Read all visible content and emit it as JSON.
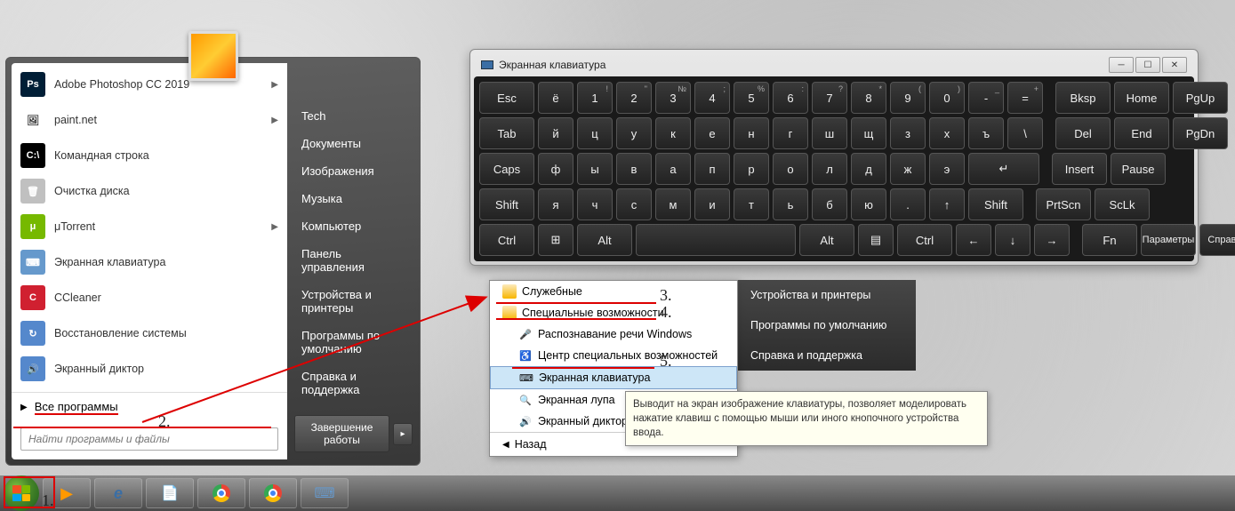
{
  "start_menu": {
    "programs": [
      {
        "label": "Adobe Photoshop CC 2019",
        "icon_bg": "#001e36",
        "icon_text": "Ps",
        "has_sub": true
      },
      {
        "label": "paint.net",
        "icon_bg": "#ffffff",
        "icon_text": "🖼",
        "has_sub": true
      },
      {
        "label": "Командная строка",
        "icon_bg": "#000000",
        "icon_text": "C:\\",
        "has_sub": false
      },
      {
        "label": "Очистка диска",
        "icon_bg": "#c0c0c0",
        "icon_text": "🗑",
        "has_sub": false
      },
      {
        "label": "μTorrent",
        "icon_bg": "#76b900",
        "icon_text": "μ",
        "has_sub": true
      },
      {
        "label": "Экранная клавиатура",
        "icon_bg": "#6699cc",
        "icon_text": "⌨",
        "has_sub": false
      },
      {
        "label": "CCleaner",
        "icon_bg": "#d02030",
        "icon_text": "C",
        "has_sub": false
      },
      {
        "label": "Восстановление системы",
        "icon_bg": "#5588cc",
        "icon_text": "↻",
        "has_sub": false
      },
      {
        "label": "Экранный диктор",
        "icon_bg": "#5588cc",
        "icon_text": "🔊",
        "has_sub": false
      }
    ],
    "all_programs": "Все программы",
    "search_placeholder": "Найти программы и файлы",
    "right_items": [
      "Tech",
      "Документы",
      "Изображения",
      "Музыка",
      "Компьютер",
      "Панель управления",
      "Устройства и принтеры",
      "Программы по умолчанию",
      "Справка и поддержка"
    ],
    "shutdown": "Завершение работы"
  },
  "osk": {
    "title": "Экранная клавиатура",
    "rows": [
      {
        "main": [
          "Esc",
          "ё",
          "1",
          "2",
          "3",
          "4",
          "5",
          "6",
          "7",
          "8",
          "9",
          "0",
          "-",
          "="
        ],
        "mods": [
          "",
          "",
          "!",
          "\"",
          "№",
          ";",
          "%",
          ":",
          "?",
          "*",
          "(",
          ")",
          "_",
          "+"
        ],
        "right": [
          "Bksp",
          "Home",
          "PgUp"
        ]
      },
      {
        "main": [
          "Tab",
          "й",
          "ц",
          "у",
          "к",
          "е",
          "н",
          "г",
          "ш",
          "щ",
          "з",
          "х",
          "ъ",
          "\\"
        ],
        "right": [
          "Del",
          "End",
          "PgDn"
        ]
      },
      {
        "main": [
          "Caps",
          "ф",
          "ы",
          "в",
          "а",
          "п",
          "р",
          "о",
          "л",
          "д",
          "ж",
          "э",
          "↵"
        ],
        "right": [
          "Insert",
          "Pause"
        ]
      },
      {
        "main": [
          "Shift",
          "я",
          "ч",
          "с",
          "м",
          "и",
          "т",
          "ь",
          "б",
          "ю",
          ".",
          "↑",
          "Shift"
        ],
        "right": [
          "PrtScn",
          "ScLk"
        ]
      },
      {
        "main": [
          "Ctrl",
          "⊞",
          "Alt",
          "",
          "Alt",
          "▤",
          "Ctrl",
          "←",
          "↓",
          "→"
        ],
        "right": [
          "Fn",
          "Параметры",
          "Справка"
        ]
      }
    ]
  },
  "submenu": {
    "items": [
      {
        "label": "Служебные",
        "type": "folder",
        "indent": false
      },
      {
        "label": "Специальные возможности",
        "type": "folder",
        "indent": false
      },
      {
        "label": "Распознавание речи Windows",
        "type": "app",
        "icon": "🎤",
        "indent": true
      },
      {
        "label": "Центр специальных возможностей",
        "type": "app",
        "icon": "♿",
        "indent": true
      },
      {
        "label": "Экранная клавиатура",
        "type": "app",
        "icon": "⌨",
        "indent": true,
        "selected": true
      },
      {
        "label": "Экранная лупа",
        "type": "app",
        "icon": "🔍",
        "indent": true
      },
      {
        "label": "Экранный диктор",
        "type": "app",
        "icon": "🔊",
        "indent": true
      }
    ],
    "back": "Назад"
  },
  "right_sidebar2": [
    "Устройства и принтеры",
    "Программы по умолчанию",
    "Справка и поддержка"
  ],
  "tooltip": "Выводит на экран изображение клавиатуры, позволяет моделировать нажатие клавиш с помощью мыши или иного кнопочного устройства ввода.",
  "annotations": {
    "n1": "1.",
    "n2": "2.",
    "n3": "3.",
    "n4": "4.",
    "n5": "5."
  }
}
